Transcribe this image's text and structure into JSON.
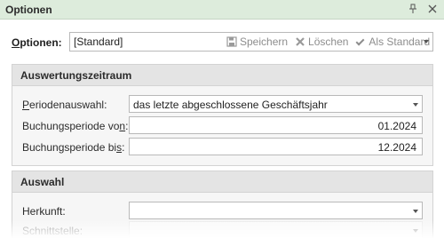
{
  "window": {
    "title": "Optionen",
    "pin_icon": "pin-icon",
    "close_icon": "close-icon"
  },
  "options": {
    "label_prefix": "O",
    "label_rest": "ptionen:",
    "value": "[Standard]",
    "save_label": "Speichern",
    "delete_label": "Löschen",
    "default_label": "Als Standard",
    "save_icon": "floppy-icon",
    "delete_icon": "x-icon",
    "default_icon": "check-icon"
  },
  "evaluation": {
    "heading": "Auswertungszeitraum",
    "period_label_prefix": "P",
    "period_label_rest": "eriodenauswahl:",
    "period_value": "das letzte abgeschlossene Geschäftsjahr",
    "from_label_pre": "Buchungsperiode vo",
    "from_label_u": "n",
    "from_label_post": ":",
    "from_value": "01.2024",
    "to_label_pre": "Buchungsperiode bi",
    "to_label_u": "s",
    "to_label_post": ":",
    "to_value": "12.2024"
  },
  "selection": {
    "heading": "Auswahl",
    "origin_label": "Herkunft:",
    "origin_value": "",
    "interface_label": "Schnittstelle:",
    "interface_value": ""
  },
  "colors": {
    "titlebar_bg": "#ddecdc",
    "group_header_bg": "#e4e4e4",
    "disabled_text": "#8d8d8d"
  }
}
